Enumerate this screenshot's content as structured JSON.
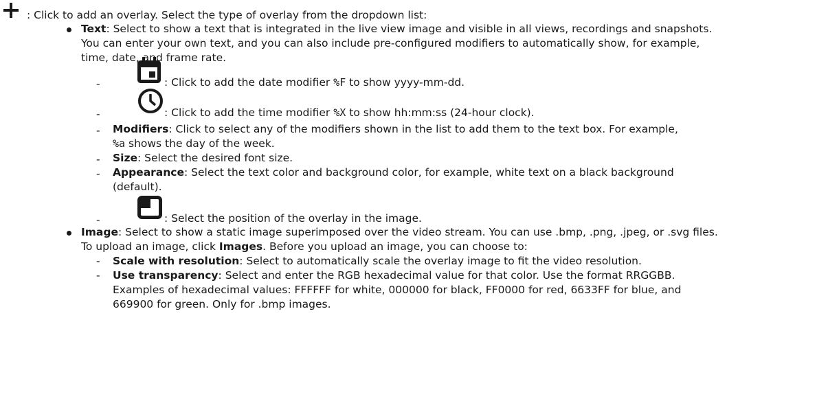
{
  "intro": {
    "text": ": Click to add an overlay. Select the type of overlay from the dropdown list:"
  },
  "text_item": {
    "term": "Text",
    "line1": ": Select to show a text that is integrated in the live view image and visible in all views, recordings and snapshots.",
    "line2": "You can enter your own text, and you can also include pre-configured modifiers to automatically show, for example,",
    "line3": "time, date, and frame rate."
  },
  "date_item": {
    "pre": ": Click to add the date modifier ",
    "code": "%F",
    "post": " to show yyyy-mm-dd."
  },
  "time_item": {
    "pre": ": Click to add the time modifier ",
    "code": "%X",
    "post": " to show hh:mm:ss (24-hour clock)."
  },
  "modifiers_item": {
    "term": "Modifiers",
    "line1": ": Click to select any of the modifiers shown in the list to add them to the text box. For example,",
    "code": "%a",
    "line2": " shows the day of the week."
  },
  "size_item": {
    "term": "Size",
    "text": ": Select the desired font size."
  },
  "appearance_item": {
    "term": "Appearance",
    "line1": ": Select the text color and background color, for example, white text on a black background",
    "line2": "(default)."
  },
  "position_item": {
    "text": ": Select the position of the overlay in the image."
  },
  "image_item": {
    "term": "Image",
    "line1": ": Select to show a static image superimposed over the video stream. You can use .bmp, .png, .jpeg, or .svg files.",
    "line2_pre": "To upload an image, click ",
    "line2_bold": "Images",
    "line2_post": ". Before you upload an image, you can choose to:"
  },
  "scale_item": {
    "term": "Scale with resolution",
    "text": ": Select to automatically scale the overlay image to fit the video resolution."
  },
  "transparency_item": {
    "term": "Use transparency",
    "line1": ": Select and enter the RGB hexadecimal value for that color. Use the format RRGGBB.",
    "line2": "Examples of hexadecimal values: FFFFFF for white, 000000 for black, FF0000 for red, 6633FF for blue, and",
    "line3": "669900 for green. Only for .bmp images."
  },
  "icons": [
    "add-icon",
    "calendar-icon",
    "clock-icon",
    "position-icon"
  ],
  "dash": "-"
}
